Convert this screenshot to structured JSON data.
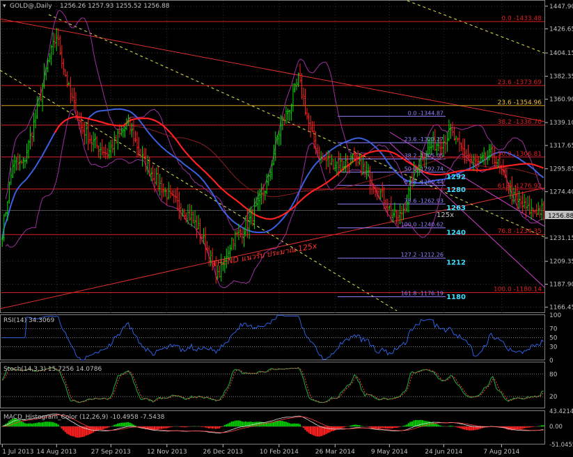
{
  "header": {
    "symbol_label": "GOLD@,Daily",
    "ohlc": "1256.26 1257.93 1255.52 1256.88"
  },
  "colors": {
    "background": "#000000",
    "grid": "#323232",
    "axis_text": "#c0c0c0",
    "fib_red": "#e02020",
    "fib_gold": "#d4a020",
    "magenta": "#d040d0",
    "violet": "#9a80ff",
    "cyan": "#40e0ff",
    "ma_blue": "#3a60e0",
    "ma_red": "#ff2020",
    "bar_green": "#00dd00",
    "bar_red": "#ff2020",
    "channel_yellow": "#e8e850"
  },
  "chart_data": [
    {
      "type": "line",
      "pane": "price",
      "title": "GOLD@,Daily",
      "ylim": [
        1161,
        1453
      ],
      "x_axis_labels": [
        "1 Jul 2013",
        "14 Aug 2013",
        "27 Sep 2013",
        "12 Nov 2013",
        "26 Dec 2013",
        "10 Feb 2014",
        "26 Mar 2014",
        "9 May 2014",
        "24 Jun 2014",
        "7 Aug 2014"
      ],
      "x_axis_label_bars": [
        0,
        31,
        62,
        94,
        126,
        158,
        190,
        221,
        252,
        285
      ],
      "y_axis_labels": [
        1166.45,
        1187.9,
        1209.35,
        1231.15,
        1252.6,
        1274.4,
        1295.85,
        1317.65,
        1339.1,
        1360.9,
        1382.35,
        1404.15,
        1426.65,
        1447.9
      ],
      "current_price": 1256.88,
      "price_path": [
        [
          0,
          1236
        ],
        [
          6,
          1300
        ],
        [
          12,
          1300
        ],
        [
          20,
          1350
        ],
        [
          26,
          1395
        ],
        [
          31,
          1420
        ],
        [
          38,
          1370
        ],
        [
          45,
          1335
        ],
        [
          52,
          1320
        ],
        [
          60,
          1310
        ],
        [
          68,
          1330
        ],
        [
          72,
          1338
        ],
        [
          80,
          1305
        ],
        [
          88,
          1285
        ],
        [
          95,
          1270
        ],
        [
          102,
          1260
        ],
        [
          108,
          1250
        ],
        [
          112,
          1240
        ],
        [
          116,
          1225
        ],
        [
          120,
          1205
        ],
        [
          123,
          1195
        ],
        [
          127,
          1210
        ],
        [
          131,
          1230
        ],
        [
          136,
          1235
        ],
        [
          142,
          1250
        ],
        [
          146,
          1262
        ],
        [
          152,
          1285
        ],
        [
          156,
          1320
        ],
        [
          160,
          1340
        ],
        [
          165,
          1357
        ],
        [
          169,
          1380
        ],
        [
          172,
          1360
        ],
        [
          176,
          1330
        ],
        [
          182,
          1305
        ],
        [
          188,
          1302
        ],
        [
          194,
          1300
        ],
        [
          200,
          1305
        ],
        [
          206,
          1295
        ],
        [
          212,
          1283
        ],
        [
          218,
          1268
        ],
        [
          222,
          1255
        ],
        [
          226,
          1248
        ],
        [
          230,
          1262
        ],
        [
          236,
          1295
        ],
        [
          240,
          1310
        ],
        [
          246,
          1318
        ],
        [
          252,
          1322
        ],
        [
          256,
          1330
        ],
        [
          260,
          1318
        ],
        [
          264,
          1312
        ],
        [
          268,
          1302
        ],
        [
          272,
          1300
        ],
        [
          276,
          1306
        ],
        [
          280,
          1310
        ],
        [
          284,
          1296
        ],
        [
          288,
          1282
        ],
        [
          292,
          1268
        ],
        [
          296,
          1263
        ],
        [
          300,
          1257
        ]
      ],
      "fib_levels_red": [
        {
          "label": "0.0 -1433.48",
          "value": 1433.48
        },
        {
          "label": "23.6 -1373.69",
          "value": 1373.69
        },
        {
          "label": "38.2 -1336.70",
          "value": 1336.7
        },
        {
          "label": "50.0 -1306.81",
          "value": 1306.81
        },
        {
          "label": "61.8 -1276.92",
          "value": 1276.92
        },
        {
          "label": "76.8 -1234.35",
          "value": 1234.35
        },
        {
          "label": "100.0 -1180.14",
          "value": 1180.14
        }
      ],
      "fib_level_gold": {
        "label": "23.6 -1354.96",
        "value": 1354.96
      },
      "fib_levels_violet": [
        {
          "label": "0.0 -1344.87",
          "value": 1344.87
        },
        {
          "label": "23.6 -1320.27",
          "value": 1320.27
        },
        {
          "label": "38.2 -1305.05",
          "value": 1305.05
        },
        {
          "label": "50.0 -1292.74",
          "value": 1292.74
        },
        {
          "label": "61.8 -1280.44",
          "value": 1280.44
        },
        {
          "label": "78.6 -1262.93",
          "value": 1262.93
        },
        {
          "label": "100.0 -1240.62",
          "value": 1240.62
        },
        {
          "label": "127.2 -1212.26",
          "value": 1212.26
        },
        {
          "label": "161.8 -1176.19",
          "value": 1176.19
        }
      ],
      "targets_cyan": [
        {
          "label": "1292",
          "value": 1292
        },
        {
          "label": "1280",
          "value": 1280
        },
        {
          "label": "1263",
          "value": 1263
        },
        {
          "label": "1240",
          "value": 1240
        },
        {
          "label": "1212",
          "value": 1212
        },
        {
          "label": "1180",
          "value": 1180
        }
      ],
      "annotations": [
        "TREND แนวรับ ประมาณ 125x",
        "125x"
      ]
    },
    {
      "type": "line",
      "pane": "rsi",
      "title": "RSI(14) 34.3069",
      "ylim": [
        0,
        100
      ],
      "levels": [
        70,
        50,
        30
      ],
      "y_axis_labels": [
        "100",
        "70",
        "50",
        "30",
        "0"
      ]
    },
    {
      "type": "line",
      "pane": "stochastic",
      "title": "Stoch(14,3,3) 15.7256 14.0786",
      "ylim": [
        0,
        100
      ],
      "levels": [
        80,
        20
      ],
      "y_axis_labels": [
        "80",
        "20"
      ]
    },
    {
      "type": "bar",
      "pane": "macd",
      "title": "MACD_Histogram_Color (12,26,9) -10.4958 -7.5438",
      "ylim": [
        -51.0455,
        43.4214
      ],
      "y_axis_labels": [
        "43.4214",
        "0.00",
        "-51.0455"
      ]
    }
  ]
}
